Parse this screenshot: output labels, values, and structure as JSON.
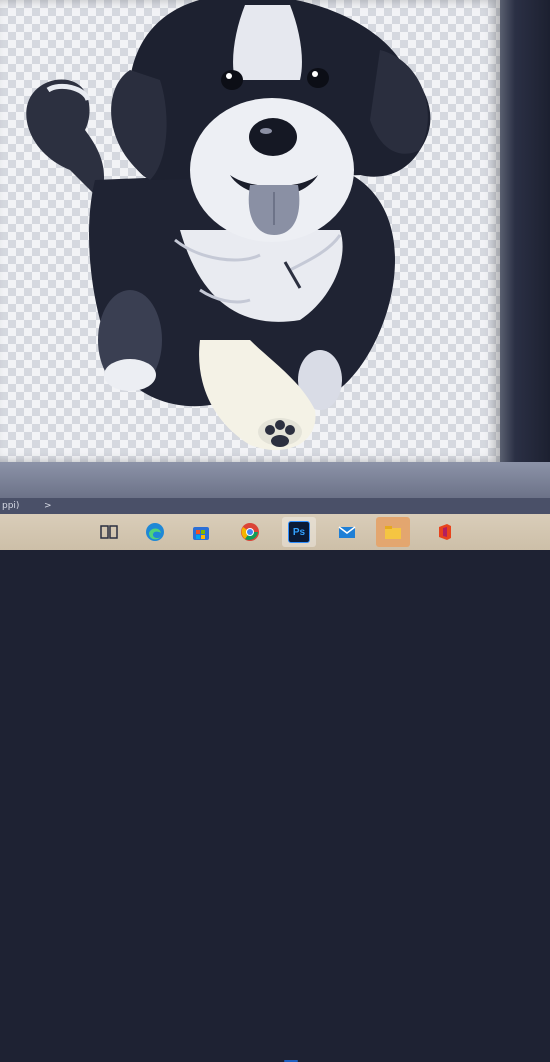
{
  "statusbar": {
    "text": "ppi)",
    "arrow": ">"
  },
  "canvas": {
    "background": "transparent-checkerboard",
    "subject": "dog-illustration"
  },
  "taskbar": {
    "items": [
      {
        "icon": "task-view-icon"
      },
      {
        "icon": "edge-icon"
      },
      {
        "icon": "store-icon"
      },
      {
        "icon": "chrome-icon"
      },
      {
        "icon": "photoshop-icon",
        "label": "Ps",
        "active": true
      },
      {
        "icon": "mail-icon"
      },
      {
        "icon": "file-explorer-icon",
        "highlight": true
      },
      {
        "icon": "office-icon"
      }
    ]
  },
  "colors": {
    "accent": "#2f8fff",
    "taskbar": "#d9cdb9",
    "highlight": "#e3a66f"
  }
}
